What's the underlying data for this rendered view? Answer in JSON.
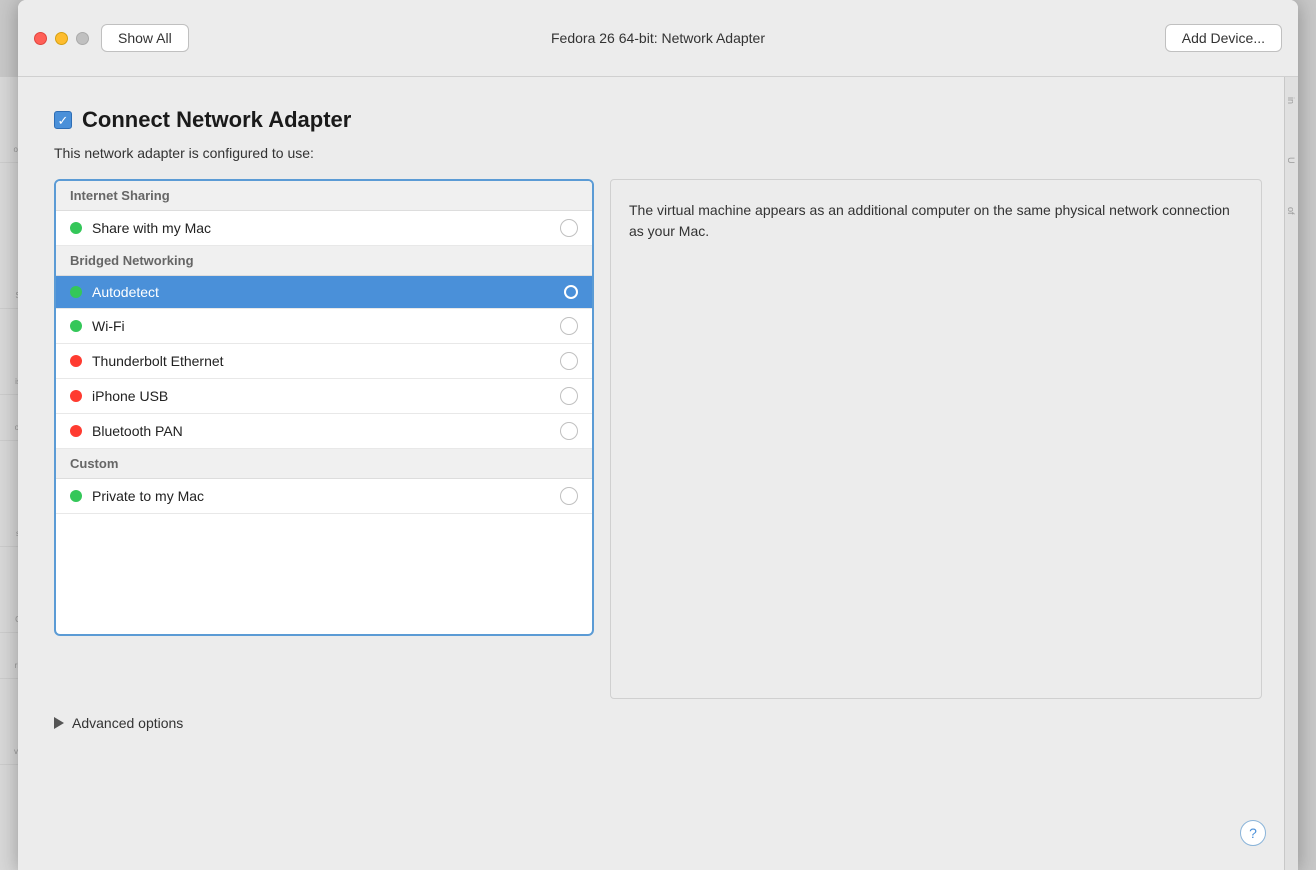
{
  "titlebar": {
    "title": "Fedora 26 64-bit: Network Adapter",
    "show_all_label": "Show All",
    "add_device_label": "Add Device..."
  },
  "content": {
    "connect_label": "Connect Network Adapter",
    "subtitle": "This network adapter is configured to use:",
    "sections": [
      {
        "id": "internet-sharing",
        "header": "Internet Sharing",
        "items": [
          {
            "id": "share-mac",
            "label": "Share with my Mac",
            "dot_color": "green",
            "selected": false
          }
        ]
      },
      {
        "id": "bridged-networking",
        "header": "Bridged Networking",
        "items": [
          {
            "id": "autodetect",
            "label": "Autodetect",
            "dot_color": "green",
            "selected": true
          },
          {
            "id": "wifi",
            "label": "Wi-Fi",
            "dot_color": "green",
            "selected": false
          },
          {
            "id": "thunderbolt",
            "label": "Thunderbolt Ethernet",
            "dot_color": "red",
            "selected": false
          },
          {
            "id": "iphone-usb",
            "label": "iPhone USB",
            "dot_color": "red",
            "selected": false
          },
          {
            "id": "bluetooth-pan",
            "label": "Bluetooth PAN",
            "dot_color": "red",
            "selected": false
          }
        ]
      },
      {
        "id": "custom",
        "header": "Custom",
        "items": [
          {
            "id": "private-mac",
            "label": "Private to my Mac",
            "dot_color": "green",
            "selected": false
          }
        ]
      }
    ],
    "description": "The virtual machine appears as an additional computer on the same physical network connection as your Mac.",
    "advanced_label": "Advanced options"
  }
}
